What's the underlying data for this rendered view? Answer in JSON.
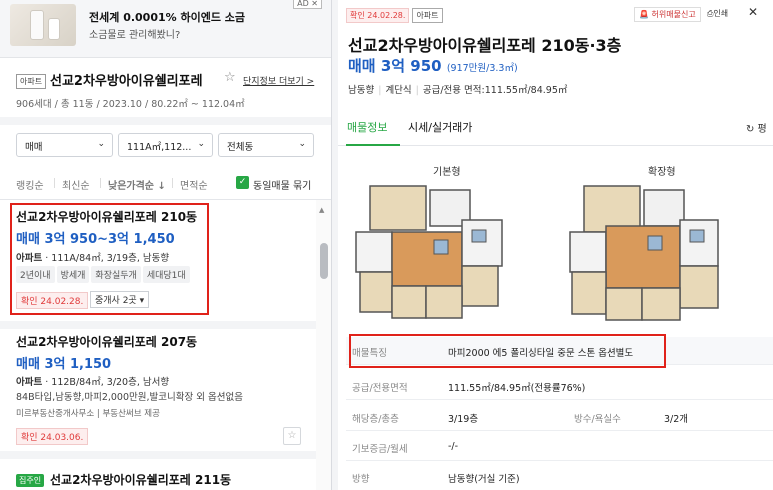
{
  "ad": {
    "title": "전세계 0.0001% 하이엔드 소금",
    "subtitle": "소금물로 관리해봤니?",
    "badge": "AD ✕"
  },
  "complex": {
    "type": "아파트",
    "name": "선교2차우방아이유쉘리포레",
    "more_link": "단지정보 더보기 >",
    "info": "906세대 / 총 11동 / 2023.10 / 80.22㎡ ~ 112.04㎡"
  },
  "filters": {
    "deal": "매매",
    "area": "111A㎡,112...",
    "dong": "전체동"
  },
  "sort": {
    "items": [
      "랭킹순",
      "최신순",
      "낮은가격순 ↓",
      "면적순"
    ],
    "same_listing": "동일매물 묶기"
  },
  "listings": [
    {
      "title": "선교2차우방아이유쉘리포레 210동",
      "price": "매매 3억 950~3억 1,450",
      "spec_type": "아파트",
      "spec": " · 111A/84㎡, 3/19층, 남동향",
      "chips": [
        "2년이내",
        "방세개",
        "화장실두개",
        "세대당1대"
      ],
      "confirm": "확인 24.02.28.",
      "agents": "중개사 2곳 ▾"
    },
    {
      "title": "선교2차우방아이유쉘리포레 207동",
      "price": "매매 3억 1,150",
      "spec_type": "아파트",
      "spec": " · 112B/84㎡, 3/20층, 남서향",
      "desc": "84B타입,남동향,마피2,000만원,발코니확장 외 옵션없음",
      "agency": "미르부동산중개사무소 | 부동산써브 제공",
      "confirm": "확인 24.03.06."
    },
    {
      "badge": "집주인",
      "title": "선교2차우방아이유쉘리포레 211동"
    }
  ],
  "detail": {
    "confirm": "확인 24.02.28.",
    "type": "아파트",
    "report": "허위매물신고",
    "print": "인쇄",
    "close": "✕",
    "title": "선교2차우방아이유쉘리포레 210동·3층",
    "price": "매매 3억 950",
    "price_per": "(917만원/3.3㎡)",
    "meta": [
      "남동향",
      "계단식",
      "공급/전용 면적:111.55㎡/84.95㎡"
    ],
    "tabs": [
      "매물정보",
      "시세/실거래가"
    ],
    "refresh": "↻ 평",
    "plans": [
      "기본형",
      "확장형"
    ],
    "rows": [
      {
        "k": "매물특징",
        "v": "마피2000 에5 폴리싱타일 중문 스톤 옵션별도"
      },
      {
        "k": "공급/전용면적",
        "v": "111.55㎡/84.95㎡(전용률76%)"
      },
      {
        "k": "해당층/총층",
        "v": "3/19층",
        "k2": "방수/욕실수",
        "v2": "3/2개"
      },
      {
        "k": "기보증금/월세",
        "v": "-/-"
      },
      {
        "k": "방향",
        "v": "남동향(거실 기준)"
      }
    ]
  },
  "colors": {
    "price_blue": "#1f5fc2",
    "accent_green": "#27a745",
    "highlight_red": "#e0221a"
  }
}
